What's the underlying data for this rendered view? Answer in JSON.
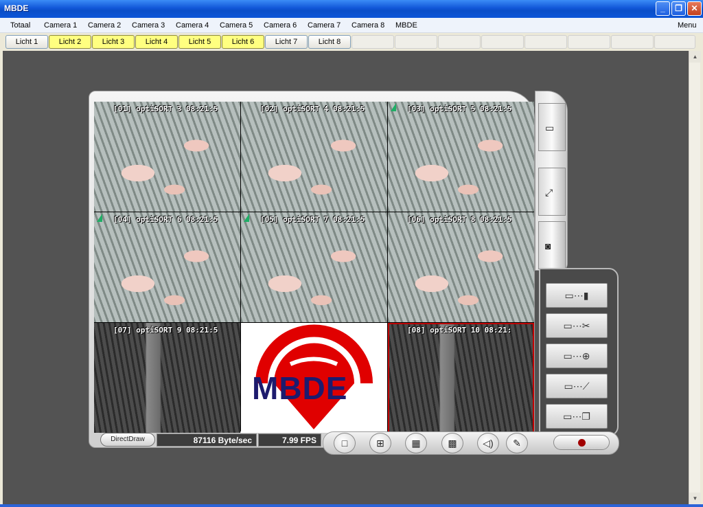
{
  "window": {
    "title": "MBDE",
    "controls": {
      "minimize": "_",
      "maximize": "❐",
      "close": "✕"
    }
  },
  "menu": {
    "items": [
      "Totaal",
      "Camera 1",
      "Camera 2",
      "Camera 3",
      "Camera 4",
      "Camera 5",
      "Camera 6",
      "Camera 7",
      "Camera 8",
      "MBDE"
    ],
    "right": "Menu"
  },
  "lights": [
    {
      "label": "Licht 1",
      "on": false
    },
    {
      "label": "Licht 2",
      "on": true
    },
    {
      "label": "Licht 3",
      "on": true
    },
    {
      "label": "Licht 4",
      "on": true
    },
    {
      "label": "Licht 5",
      "on": true
    },
    {
      "label": "Licht 6",
      "on": true
    },
    {
      "label": "Licht 7",
      "on": false
    },
    {
      "label": "Licht 8",
      "on": false
    }
  ],
  "cameras": [
    {
      "overlay": "[01] optiSORT 3 08:21:5",
      "mode": "day",
      "flag": false
    },
    {
      "overlay": "[02] optiSORT 4 08:21:5",
      "mode": "day",
      "flag": false
    },
    {
      "overlay": "[03] optiSORT 5 08:21:5",
      "mode": "day",
      "flag": true
    },
    {
      "overlay": "[04] optiSORT 6 08:21:5",
      "mode": "day",
      "flag": true
    },
    {
      "overlay": "[05] optiSORT 7 08:21:5",
      "mode": "day",
      "flag": true
    },
    {
      "overlay": "[06] optiSORT 8 08:21:5",
      "mode": "day",
      "flag": false
    },
    {
      "overlay": "[07] optiSORT 9 08:21:5",
      "mode": "night",
      "flag": false
    },
    {
      "overlay": "",
      "mode": "logo",
      "flag": false
    },
    {
      "overlay": "[08] optiSORT 10 08:21:",
      "mode": "night",
      "flag": false,
      "selected": true
    }
  ],
  "logo": {
    "text": "MBDE",
    "red": "#e00000",
    "blue": "#1d1b6e"
  },
  "status": {
    "renderer": "DirectDraw",
    "byterate": "87116 Byte/sec",
    "fps": "7.99 FPS"
  },
  "icons": {
    "side": [
      "camera-icon",
      "fullscreen-icon",
      "snapshot-icon"
    ],
    "tools": [
      "monitor-remote-icon",
      "settings-tools-icon",
      "zoom-add-icon",
      "ptz-icon",
      "multi-window-icon"
    ],
    "layout": [
      "layout-1-icon",
      "layout-4-icon",
      "layout-9-icon",
      "layout-16-icon",
      "audio-icon",
      "edit-icon"
    ],
    "record": "record-icon"
  },
  "colors": {
    "light_on": "#ffff80",
    "selected_outline": "#c00000",
    "workspace": "#535353"
  }
}
